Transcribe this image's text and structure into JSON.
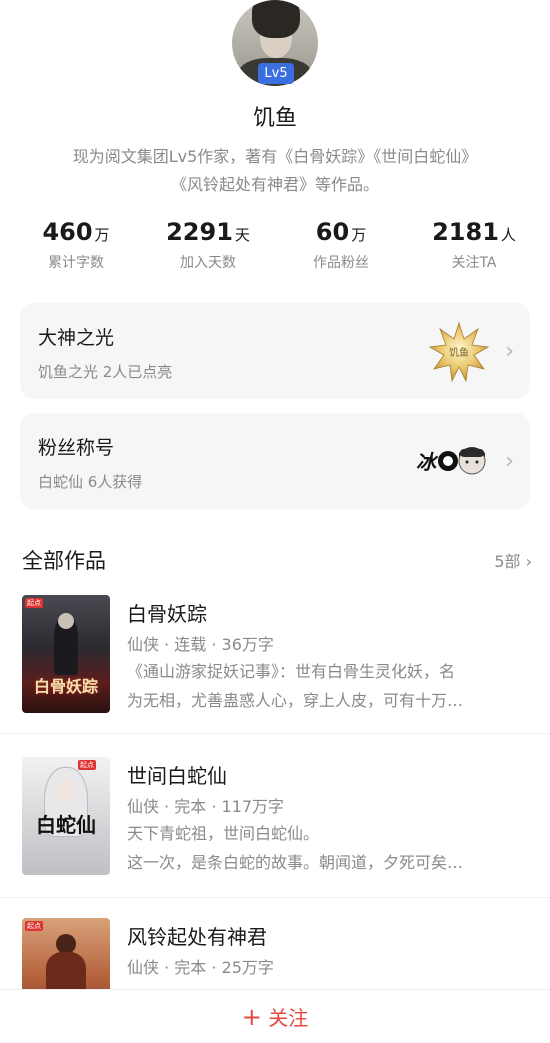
{
  "profile": {
    "level_badge": "Lv5",
    "name": "饥鱼",
    "bio_line1": "现为阅文集团Lv5作家，著有《白骨妖踪》《世间白蛇仙》",
    "bio_line2": "《风铃起处有神君》等作品。"
  },
  "stats": [
    {
      "value": "460",
      "unit": "万",
      "label": "累计字数"
    },
    {
      "value": "2291",
      "unit": "天",
      "label": "加入天数"
    },
    {
      "value": "60",
      "unit": "万",
      "label": "作品粉丝"
    },
    {
      "value": "2181",
      "unit": "人",
      "label": "关注TA"
    }
  ],
  "cards": {
    "dashen": {
      "title": "大神之光",
      "sub": "饥鱼之光  2人已点亮",
      "medal_text": "饥鱼"
    },
    "fans": {
      "title": "粉丝称号",
      "sub": "白蛇仙  6人获得",
      "badge_text": "冰"
    }
  },
  "works": {
    "title": "全部作品",
    "count": "5部",
    "books": [
      {
        "title": "白骨妖踪",
        "meta": "仙侠 · 连载 · 36万字",
        "desc1": "《通山游家捉妖记事》：世有白骨生灵化妖，名",
        "desc2": "为无相，尤善蛊惑人心，穿上人皮，可有十万…",
        "cover_text": "白骨妖踪"
      },
      {
        "title": "世间白蛇仙",
        "meta": "仙侠 · 完本 · 117万字",
        "desc1": "天下青蛇祖，世间白蛇仙。",
        "desc2": "这一次，是条白蛇的故事。朝闻道，夕死可矣…",
        "cover_text": "白蛇仙"
      },
      {
        "title": "风铃起处有神君",
        "meta": "仙侠 · 完本 · 25万字",
        "desc1": "",
        "desc2": ""
      }
    ]
  },
  "bottom": {
    "follow_icon": "+",
    "follow_label": "关注"
  },
  "colors": {
    "accent": "#e5483d",
    "badge_blue": "#3b6fe0",
    "card_bg": "#f6f6f6",
    "muted": "#8a8a8a"
  }
}
